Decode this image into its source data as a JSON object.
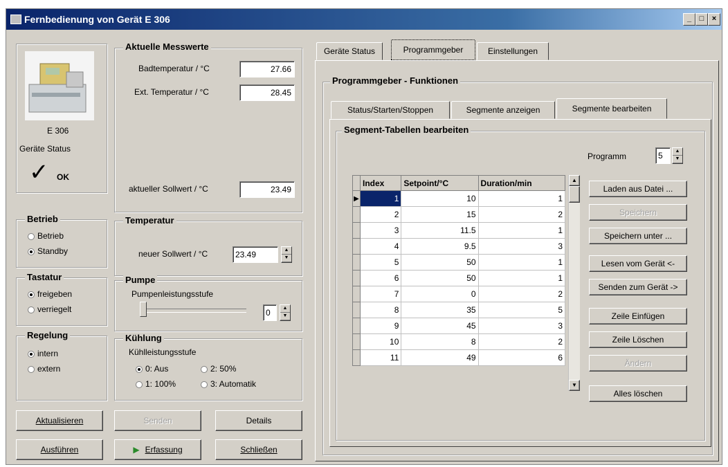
{
  "window": {
    "title": "Fernbedienung von Gerät E 306"
  },
  "device": {
    "name": "E 306",
    "status_label": "Geräte Status",
    "status_value": "OK"
  },
  "measurements": {
    "title": "Aktuelle Messwerte",
    "bath_label": "Badtemperatur / °C",
    "bath_value": "27.66",
    "ext_label": "Ext. Temperatur / °C",
    "ext_value": "28.45",
    "setpoint_label": "aktueller Sollwert / °C",
    "setpoint_value": "23.49"
  },
  "betrieb": {
    "title": "Betrieb",
    "options": [
      "Betrieb",
      "Standby"
    ],
    "selected": 1
  },
  "temperatur": {
    "title": "Temperatur",
    "new_setpoint_label": "neuer Sollwert / °C",
    "new_setpoint_value": "23.49"
  },
  "tastatur": {
    "title": "Tastatur",
    "options": [
      "freigeben",
      "verriegelt"
    ],
    "selected": 0
  },
  "pumpe": {
    "title": "Pumpe",
    "level_label": "Pumpenleistungsstufe",
    "level_value": "0"
  },
  "regelung": {
    "title": "Regelung",
    "options": [
      "intern",
      "extern"
    ],
    "selected": 0
  },
  "kuehlung": {
    "title": "Kühlung",
    "level_label": "Kühlleistungsstufe",
    "options": [
      "0: Aus",
      "2: 50%",
      "1: 100%",
      "3: Automatik"
    ],
    "selected": 0
  },
  "buttons": {
    "aktualisieren": "Aktualisieren",
    "disabled_top": "Senden",
    "details": "Details",
    "ausfuehren": "Ausführen",
    "erfassung": "Erfassung",
    "schliessen": "Schließen"
  },
  "main_tabs": [
    "Geräte Status",
    "Programmgeber",
    "Einstellungen"
  ],
  "programmgeber": {
    "title": "Programmgeber - Funktionen",
    "sub_tabs": [
      "Status/Starten/Stoppen",
      "Segmente anzeigen",
      "Segmente bearbeiten"
    ],
    "section_title": "Segment-Tabellen bearbeiten",
    "program_label": "Programm",
    "program_value": "5",
    "columns": [
      "Index",
      "Setpoint/°C",
      "Duration/min"
    ],
    "rows": [
      [
        "1",
        "10",
        "1"
      ],
      [
        "2",
        "15",
        "2"
      ],
      [
        "3",
        "11.5",
        "1"
      ],
      [
        "4",
        "9.5",
        "3"
      ],
      [
        "5",
        "50",
        "1"
      ],
      [
        "6",
        "50",
        "1"
      ],
      [
        "7",
        "0",
        "2"
      ],
      [
        "8",
        "35",
        "5"
      ],
      [
        "9",
        "45",
        "3"
      ],
      [
        "10",
        "8",
        "2"
      ],
      [
        "11",
        "49",
        "6"
      ]
    ],
    "side_buttons": [
      "Laden aus Datei ...",
      "Speichern",
      "Speichern unter ...",
      "Lesen vom Gerät <-",
      "Senden zum Gerät ->",
      "Zeile Einfügen",
      "Zeile Löschen",
      "Ändern",
      "Alles löschen"
    ]
  }
}
